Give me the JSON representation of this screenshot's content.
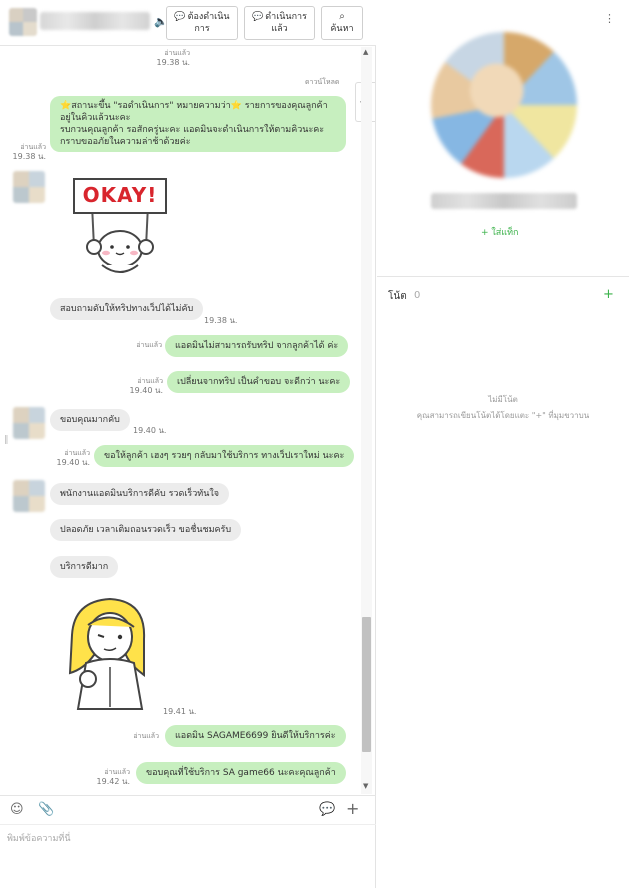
{
  "header": {
    "mute_icon": "speaker-icon",
    "todo_button": "ต้องดำเนินการ",
    "done_button": "ดำเนินการแล้ว",
    "search_button": "ค้นหา"
  },
  "messages": {
    "read_label": "อ่านแล้ว",
    "download_label": "ดาวน์โหลด",
    "m1_time": "19.38 น.",
    "m2_text_l1": "⭐สถานะขึ้น \"รอดำเนินการ\" หมายความว่า⭐ รายการของคุณลูกค้า",
    "m2_text_l2": "อยู่ในคิวแล้วนะคะ",
    "m2_text_l3": "รบกวนคุณลูกค้า รอสักครู่นะคะ แอดมินจะดำเนินการให้ตามคิวนะคะ",
    "m2_text_l4": "กราบขออภัยในความล่าช้าด้วยค่ะ",
    "m2_time": "19.38 น.",
    "sticker1_text": "OKAY!",
    "m3_text": "สอบถามดับให้ทริปทางเว็ปได้ไม่คับ",
    "m3_time": "19.38 น.",
    "m4_text": "แอดมินไม่สามารถรับทริป จากลูกค้าได้ ค่ะ",
    "m5_text": "เปลี่ยนจากทริป เป็นคำขอบ จะดีกว่า นะคะ",
    "m5_time": "19.40 น.",
    "m6_text": "ขอบคุณมากคับ",
    "m6_time": "19.40 น.",
    "m7_text": "ขอให้ลูกค้า เฮงๆ รวยๆ กลับมาใช้บริการ ทางเว็ปเราใหม่ นะคะ",
    "m7_time": "19.40 น.",
    "m8_text": "พนักงานแอดมินบริการดีคับ รวดเร็วทันใจ",
    "m9_text": "ปลอดภัย เวลาเติมถอนรวดเร็ว ขอชื่นชมครับ",
    "m10_text": "บริการดีมาก",
    "sticker2_time": "19.41 น.",
    "m11_text": "แอดมิน SAGAME6699 ยินดีให้บริการค่ะ",
    "m12_text": "ขอบคุณที่ใช้บริการ SA game66 นะคะคุณลูกค้า",
    "m12_time": "19.42 น."
  },
  "composer": {
    "placeholder": "พิมพ์ข้อความที่นี่",
    "emoji_icon": "smiley-icon",
    "attach_icon": "paperclip-icon",
    "sticker_icon": "chat-bubble-icon",
    "add_icon": "plus-icon"
  },
  "profile": {
    "add_tag": "+ ใส่แท็ก",
    "notes_title": "โน้ต",
    "notes_count": "0",
    "notes_add": "+",
    "notes_empty": "ไม่มีโน้ต",
    "notes_hint": "คุณสามารถเขียนโน้ตได้โดยแตะ \"+\" ที่มุมขวาบน"
  },
  "colors": {
    "bubble_out": "#c7efbf",
    "bubble_in": "#ececec",
    "accent": "#3bb24a"
  }
}
